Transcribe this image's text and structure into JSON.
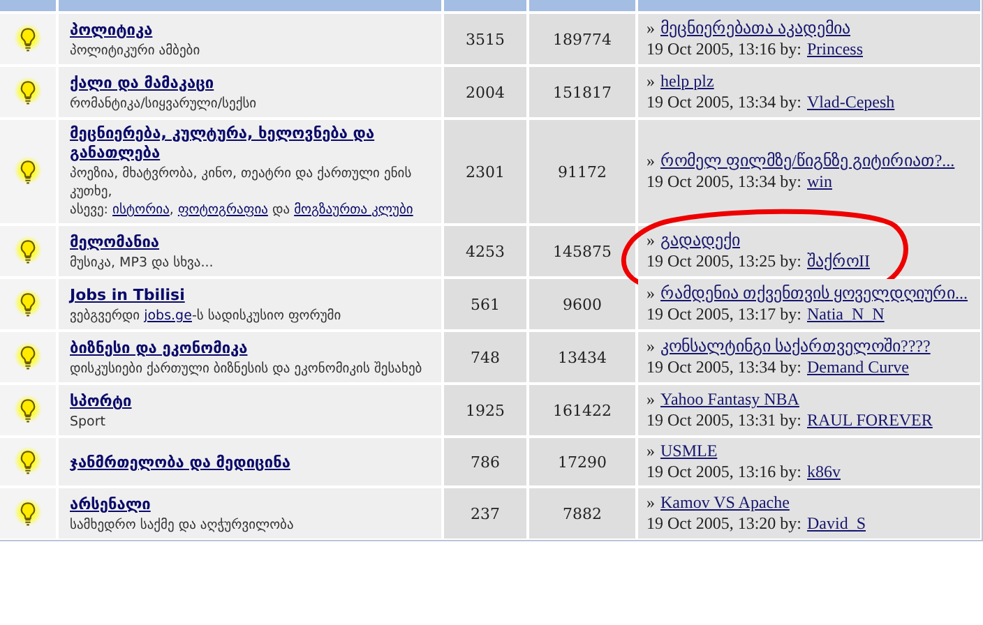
{
  "forums": [
    {
      "title": "პოლიტიკა",
      "description": [
        [
          {
            "text": "პოლიტიკური ამბები",
            "link": false
          }
        ]
      ],
      "topics": "3515",
      "posts": "189774",
      "last_post": {
        "marker": "»",
        "topic": "მეცნიერებათა აკადემია",
        "byline": "19 Oct 2005, 13:16 by:",
        "author": "Princess",
        "circled": false
      }
    },
    {
      "title": "ქალი და მამაკაცი",
      "description": [
        [
          {
            "text": "რომანტიკა/სიყვარული/სექსი",
            "link": false
          }
        ]
      ],
      "topics": "2004",
      "posts": "151817",
      "last_post": {
        "marker": "»",
        "topic": "help plz",
        "byline": "19 Oct 2005, 13:34 by:",
        "author": "Vlad-Cepesh",
        "circled": false
      }
    },
    {
      "title": "მეცნიერება, კულტურა, ხელოვნება და განათლება",
      "description": [
        [
          {
            "text": "პოეზია, მხატვრობა, კინო, თეატრი და ქართული ენის კუთხე,",
            "link": false
          }
        ],
        [
          {
            "text": "ასევე: ",
            "link": false
          },
          {
            "text": "ისტორია",
            "link": true
          },
          {
            "text": ", ",
            "link": false
          },
          {
            "text": "ფოტოგრაფია",
            "link": true
          },
          {
            "text": " და ",
            "link": false
          },
          {
            "text": "მოგზაურთა კლუბი",
            "link": true
          }
        ]
      ],
      "topics": "2301",
      "posts": "91172",
      "last_post": {
        "marker": "»",
        "topic": "რომელ ფილმზე/წიგნზე გიტირიათ?...",
        "byline": "19 Oct 2005, 13:34 by:",
        "author": "win",
        "circled": false
      }
    },
    {
      "title": "მელომანია",
      "description": [
        [
          {
            "text": "მუსიკა, MP3 და სხვა...",
            "link": false
          }
        ]
      ],
      "topics": "4253",
      "posts": "145875",
      "last_post": {
        "marker": "»",
        "topic": "გადადექი",
        "byline": "19 Oct 2005, 13:25 by:",
        "author": "შაქროII",
        "circled": true
      }
    },
    {
      "title": "Jobs in Tbilisi",
      "description": [
        [
          {
            "text": "ვებგვერდი ",
            "link": false
          },
          {
            "text": "jobs.ge",
            "link": true
          },
          {
            "text": "-ს სადისკუსიო ფორუმი",
            "link": false
          }
        ]
      ],
      "topics": "561",
      "posts": "9600",
      "last_post": {
        "marker": "»",
        "topic": "რამდენია თქვენთვის ყოველდღიური...",
        "byline": "19 Oct 2005, 13:17 by:",
        "author": "Natia_N_N",
        "circled": false
      }
    },
    {
      "title": "ბიზნესი და ეკონომიკა",
      "description": [
        [
          {
            "text": "დისკუსიები ქართული ბიზნესის და ეკონომიკის შესახებ",
            "link": false
          }
        ]
      ],
      "topics": "748",
      "posts": "13434",
      "last_post": {
        "marker": "»",
        "topic": "კონსალტინგი საქართველოში????",
        "byline": "19 Oct 2005, 13:34 by:",
        "author": "Demand Curve",
        "circled": false
      }
    },
    {
      "title": "სპორტი",
      "description": [
        [
          {
            "text": "Sport",
            "link": false
          }
        ]
      ],
      "topics": "1925",
      "posts": "161422",
      "last_post": {
        "marker": "»",
        "topic": "Yahoo Fantasy NBA",
        "byline": "19 Oct 2005, 13:31 by:",
        "author": "RAUL FOREVER",
        "circled": false
      }
    },
    {
      "title": "ჯანმრთელობა და მედიცინა",
      "topics": "786",
      "posts": "17290",
      "last_post": {
        "marker": "»",
        "topic": "USMLE",
        "byline": "19 Oct 2005, 13:16 by:",
        "author": "k86v",
        "circled": false
      }
    },
    {
      "title": "არსენალი",
      "description": [
        [
          {
            "text": "სამხედრო საქმე და აღჭურვილობა",
            "link": false
          }
        ]
      ],
      "topics": "237",
      "posts": "7882",
      "last_post": {
        "marker": "»",
        "topic": "Kamov VS Apache",
        "byline": "19 Oct 2005, 13:20 by:",
        "author": "David_S",
        "circled": false
      }
    }
  ]
}
